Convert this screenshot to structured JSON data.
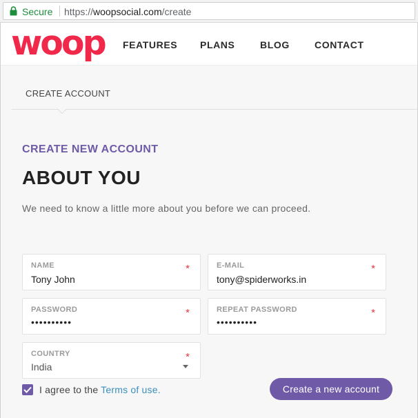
{
  "browser": {
    "secure_label": "Secure",
    "url_scheme": "https://",
    "url_host": "woopsocial.com",
    "url_path": "/create"
  },
  "header": {
    "logo": "woop",
    "nav": [
      "FEATURES",
      "PLANS",
      "BLOG",
      "CONTACT"
    ]
  },
  "breadcrumb": "CREATE ACCOUNT",
  "section": {
    "kicker": "CREATE NEW ACCOUNT",
    "title": "ABOUT YOU",
    "intro": "We need to know a little more about you before we can proceed."
  },
  "form": {
    "required_mark": "*",
    "name": {
      "label": "NAME",
      "value": "Tony John"
    },
    "email": {
      "label": "E-MAIL",
      "value": "tony@spiderworks.in"
    },
    "password": {
      "label": "PASSWORD",
      "value": "••••••••••"
    },
    "repeat_password": {
      "label": "REPEAT PASSWORD",
      "value": "••••••••••"
    },
    "country": {
      "label": "COUNTRY",
      "value": "India"
    }
  },
  "agreement": {
    "checked": true,
    "text": "I agree to the",
    "link": "Terms of use."
  },
  "submit_label": "Create a new account",
  "colors": {
    "brand": "#f0284a",
    "accent": "#6f5aa8",
    "secure": "#1e8e3e",
    "link": "#3a8fbd",
    "required": "#e0393e"
  }
}
